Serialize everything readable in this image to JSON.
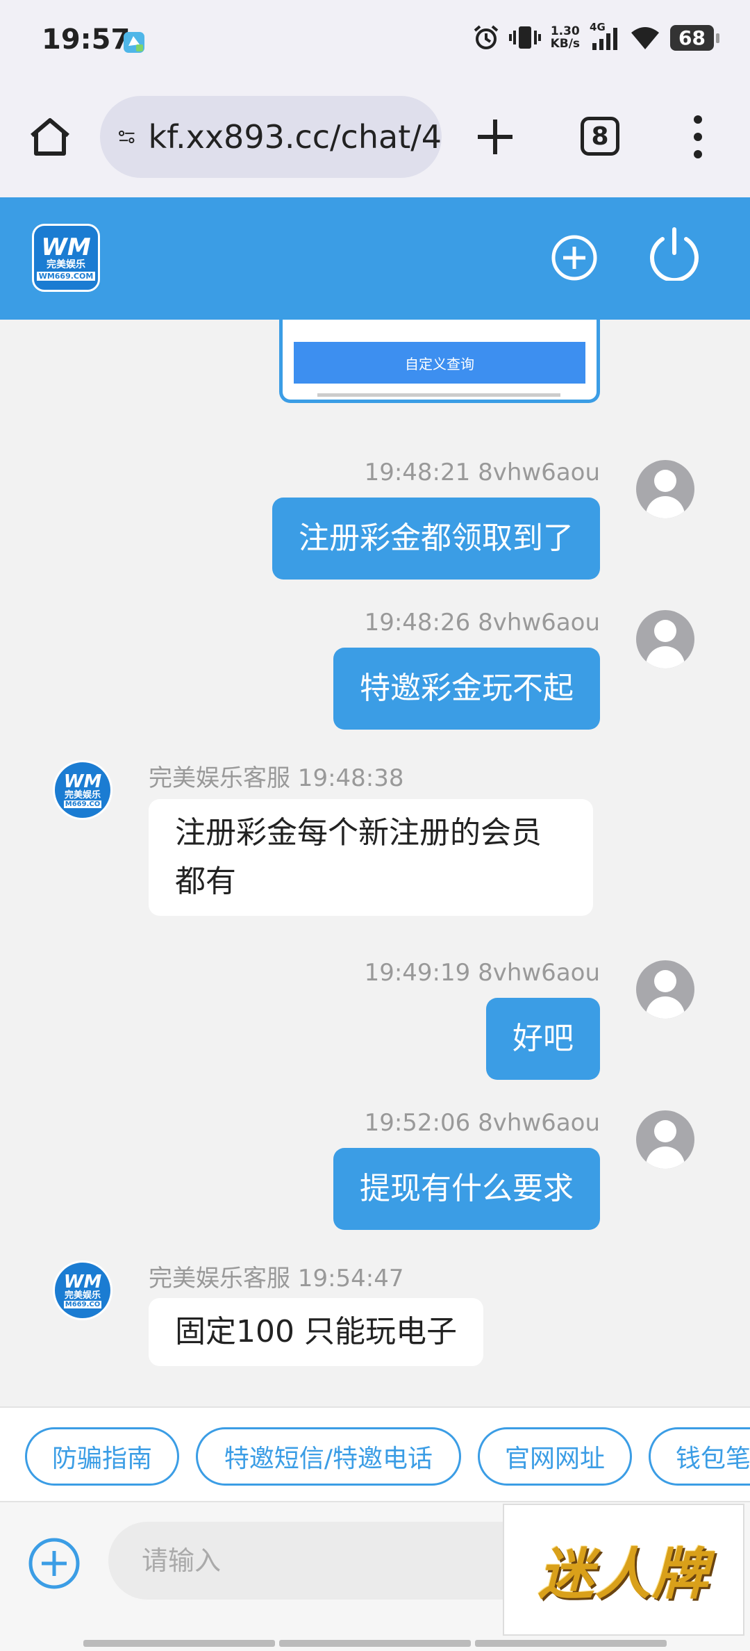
{
  "status_bar": {
    "time": "19:57",
    "net_speed_value": "1.30",
    "net_speed_unit": "KB/s",
    "network": "4G",
    "battery": "68",
    "icons": [
      "alarm-icon",
      "vibrate-icon",
      "signal-icon",
      "wifi-icon",
      "battery-icon"
    ]
  },
  "browser": {
    "url": "kf.xx893.cc/chat/4",
    "tab_count": "8"
  },
  "header": {
    "logo": {
      "line1": "WM",
      "line2": "完美娱乐",
      "line3": "WM669.COM"
    }
  },
  "chat": {
    "image_card_button": "自定义查询",
    "messages": [
      {
        "side": "out",
        "meta": "19:48:21 8vhw6aou",
        "text": "注册彩金都领取到了"
      },
      {
        "side": "out",
        "meta": "19:48:26 8vhw6aou",
        "text": "特邀彩金玩不起"
      },
      {
        "side": "in",
        "meta": "完美娱乐客服 19:48:38",
        "text": "注册彩金每个新注册的会员都有"
      },
      {
        "side": "out",
        "meta": "19:49:19 8vhw6aou",
        "text": "好吧"
      },
      {
        "side": "out",
        "meta": "19:52:06 8vhw6aou",
        "text": "提现有什么要求"
      },
      {
        "side": "in",
        "meta": "完美娱乐客服 19:54:47",
        "text": "固定100 只能玩电子"
      }
    ],
    "cs_avatar": {
      "line1": "WM",
      "line2": "完美娱乐",
      "line3": "M669.CO"
    }
  },
  "quick_replies": [
    "防骗指南",
    "特邀短信/特邀电话",
    "官网网址",
    "钱包笔"
  ],
  "input": {
    "placeholder": "请输入"
  },
  "ad": {
    "text": "迷人牌"
  },
  "colors": {
    "primary": "#3b9de5",
    "background": "#f2f2f2"
  }
}
